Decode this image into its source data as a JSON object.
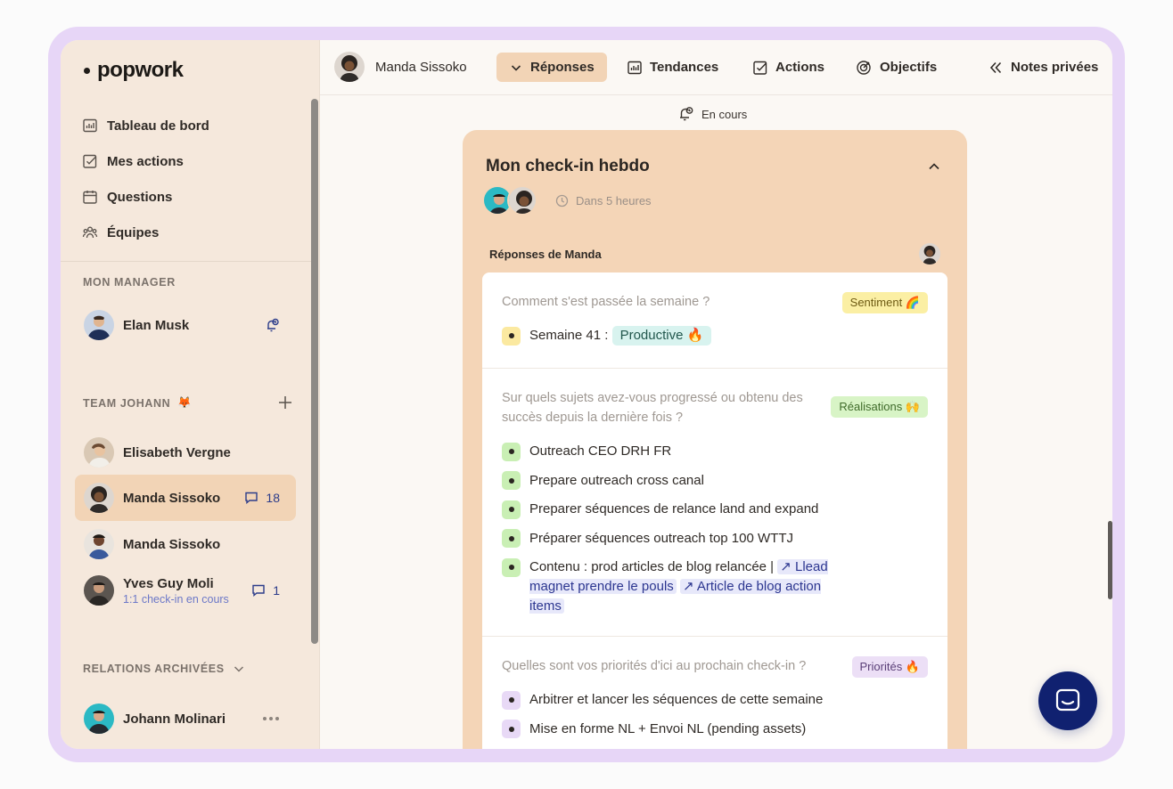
{
  "logo": {
    "text": "popwork"
  },
  "nav": [
    {
      "label": "Tableau de bord",
      "icon": "dashboard-icon"
    },
    {
      "label": "Mes actions",
      "icon": "checkbox-icon"
    },
    {
      "label": "Questions",
      "icon": "calendar-icon"
    },
    {
      "label": "Équipes",
      "icon": "team-icon"
    }
  ],
  "manager": {
    "section_label": "MON MANAGER",
    "name": "Elan Musk"
  },
  "team": {
    "section_label": "TEAM JOHANN",
    "emoji": "🦊",
    "members": [
      {
        "name": "Elisabeth Vergne",
        "sub": "",
        "count": ""
      },
      {
        "name": "Manda Sissoko",
        "sub": "",
        "count": "18"
      },
      {
        "name": "Manda Sissoko",
        "sub": "",
        "count": ""
      },
      {
        "name": "Yves Guy Moli",
        "sub": "1:1 check-in en cours",
        "count": "1"
      }
    ]
  },
  "archived": {
    "section_label": "RELATIONS ARCHIVÉES",
    "members": [
      {
        "name": "Johann Molinari"
      }
    ]
  },
  "topbar": {
    "user_name": "Manda Sissoko",
    "tabs": [
      {
        "label": "Réponses",
        "icon": "chevron-down-icon"
      },
      {
        "label": "Tendances",
        "icon": "chart-icon"
      },
      {
        "label": "Actions",
        "icon": "checkbox-icon"
      },
      {
        "label": "Objectifs",
        "icon": "target-icon"
      },
      {
        "label": "Notes privées",
        "icon": "double-chevron-left-icon"
      }
    ]
  },
  "status": {
    "label": "En cours"
  },
  "checkin": {
    "title": "Mon check-in hebdo",
    "due": "Dans 5 heures",
    "answers_label": "Réponses de Manda",
    "questions": [
      {
        "question": "Comment s'est passée la semaine ?",
        "tag": "Sentiment 🌈",
        "tag_bg": "#fbefa4",
        "tag_color": "#6d5a12",
        "bullet_color": "#fbe9a0"
      },
      {
        "question": "Sur quels sujets avez-vous progressé ou obtenu des succès depuis la dernière fois ?",
        "tag": "Réalisations 🙌",
        "tag_bg": "#d8f4c6",
        "tag_color": "#3f6b2a",
        "bullet_color": "#c9efb4",
        "answers": [
          "Outreach CEO DRH FR",
          "Prepare outreach cross canal",
          "Preparer séquences de relance land and expand",
          "Préparer séquences outreach top 100 WTTJ"
        ],
        "last_answer": {
          "prefix": "Contenu : prod articles de blog relancée |",
          "link1": "↗ Llead magnet prendre le pouls",
          "link2": "↗ Article de blog action items"
        }
      },
      {
        "question": "Quelles sont vos priorités d'ici au prochain check-in ?",
        "tag": "Priorités 🔥",
        "tag_bg": "#ecdff6",
        "tag_color": "#5a3f78",
        "bullet_color": "#e8d9f6",
        "answers": [
          "Arbitrer et lancer les séquences de cette semaine",
          "Mise en forme NL + Envoi NL (pending assets)"
        ]
      }
    ],
    "week_answer": {
      "prefix": "Semaine 41 :",
      "value": "Productive 🔥"
    }
  }
}
